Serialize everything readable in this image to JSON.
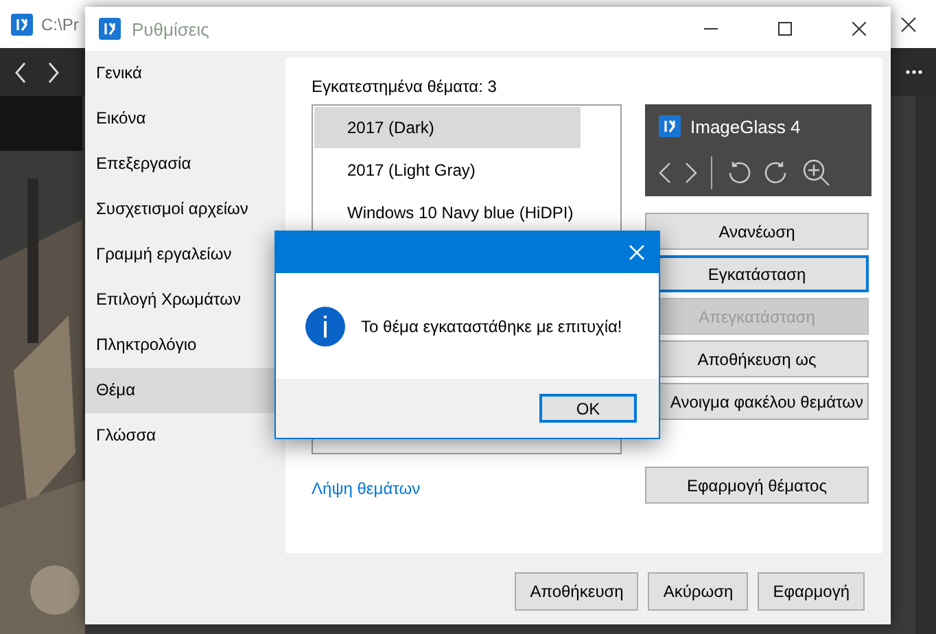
{
  "background_window": {
    "title": "C:\\Pr"
  },
  "settings_window": {
    "title": "Ρυθμίσεις",
    "sidebar": {
      "items": [
        {
          "label": "Γενικά",
          "selected": false
        },
        {
          "label": "Εικόνα",
          "selected": false
        },
        {
          "label": "Επεξεργασία",
          "selected": false
        },
        {
          "label": "Συσχετισμοί αρχείων",
          "selected": false
        },
        {
          "label": "Γραμμή εργαλείων",
          "selected": false
        },
        {
          "label": "Επιλογή Χρωμάτων",
          "selected": false
        },
        {
          "label": "Πληκτρολόγιο",
          "selected": false
        },
        {
          "label": "Θέμα",
          "selected": true
        },
        {
          "label": "Γλώσσα",
          "selected": false
        }
      ]
    },
    "theme_page": {
      "installed_label": "Εγκατεστημένα θέματα: 3",
      "themes": [
        {
          "name": "2017 (Dark)",
          "selected": true
        },
        {
          "name": "2017 (Light Gray)",
          "selected": false
        },
        {
          "name": "Windows 10 Navy blue (HiDPI)",
          "selected": false
        }
      ],
      "preview": {
        "title": "ImageGlass 4"
      },
      "buttons": [
        {
          "label": "Ανανέωση",
          "disabled": false,
          "focused": false
        },
        {
          "label": "Εγκατάσταση",
          "disabled": false,
          "focused": true
        },
        {
          "label": "Απεγκατάσταση",
          "disabled": true,
          "focused": false
        },
        {
          "label": "Αποθήκευση ως",
          "disabled": false,
          "focused": false
        },
        {
          "label": "Ανοιγμα φακέλου θεμάτων",
          "disabled": false,
          "focused": false
        }
      ],
      "download_link": "Λήψη θεμάτων",
      "apply_button": "Εφαρμογή θέματος"
    },
    "footer_buttons": [
      "Αποθήκευση",
      "Ακύρωση",
      "Εφαρμογή"
    ]
  },
  "message_dialog": {
    "message": "Το θέμα εγκαταστάθηκε με επιτυχία!",
    "buttons": [
      {
        "label": "OK",
        "focused": true
      }
    ]
  }
}
